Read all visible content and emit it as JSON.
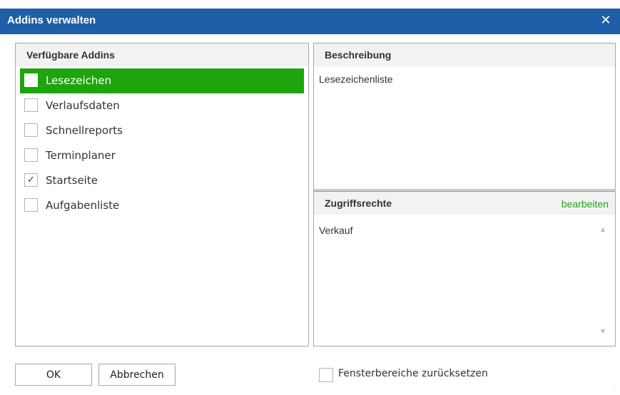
{
  "window": {
    "title": "Addins verwalten",
    "close_glyph": "✕",
    "titlebar_color": "#1f5fa8"
  },
  "addins": {
    "header": "Verfügbare Addins",
    "selected_color": "#1ea40c",
    "items": [
      {
        "label": "Lesezeichen",
        "checked": false,
        "selected": true
      },
      {
        "label": "Verlaufsdaten",
        "checked": false,
        "selected": false
      },
      {
        "label": "Schnellreports",
        "checked": false,
        "selected": false
      },
      {
        "label": "Terminplaner",
        "checked": false,
        "selected": false
      },
      {
        "label": "Startseite",
        "checked": true,
        "selected": false
      },
      {
        "label": "Aufgabenliste",
        "checked": false,
        "selected": false
      }
    ]
  },
  "description": {
    "header": "Beschreibung",
    "text": "Lesezeichenliste"
  },
  "rights": {
    "header": "Zugriffsrechte",
    "edit_label": "bearbeiten",
    "edit_color": "#2aa21a",
    "value": "Verkauf",
    "scroll_up_icon": "▲",
    "scroll_down_icon": "▼"
  },
  "footer": {
    "ok_label": "OK",
    "cancel_label": "Abbrechen",
    "reset_label": "Fensterbereiche zurücksetzen",
    "reset_checked": false
  },
  "icons": {
    "check_glyph": "✓",
    "grip_glyph": "⋰"
  }
}
